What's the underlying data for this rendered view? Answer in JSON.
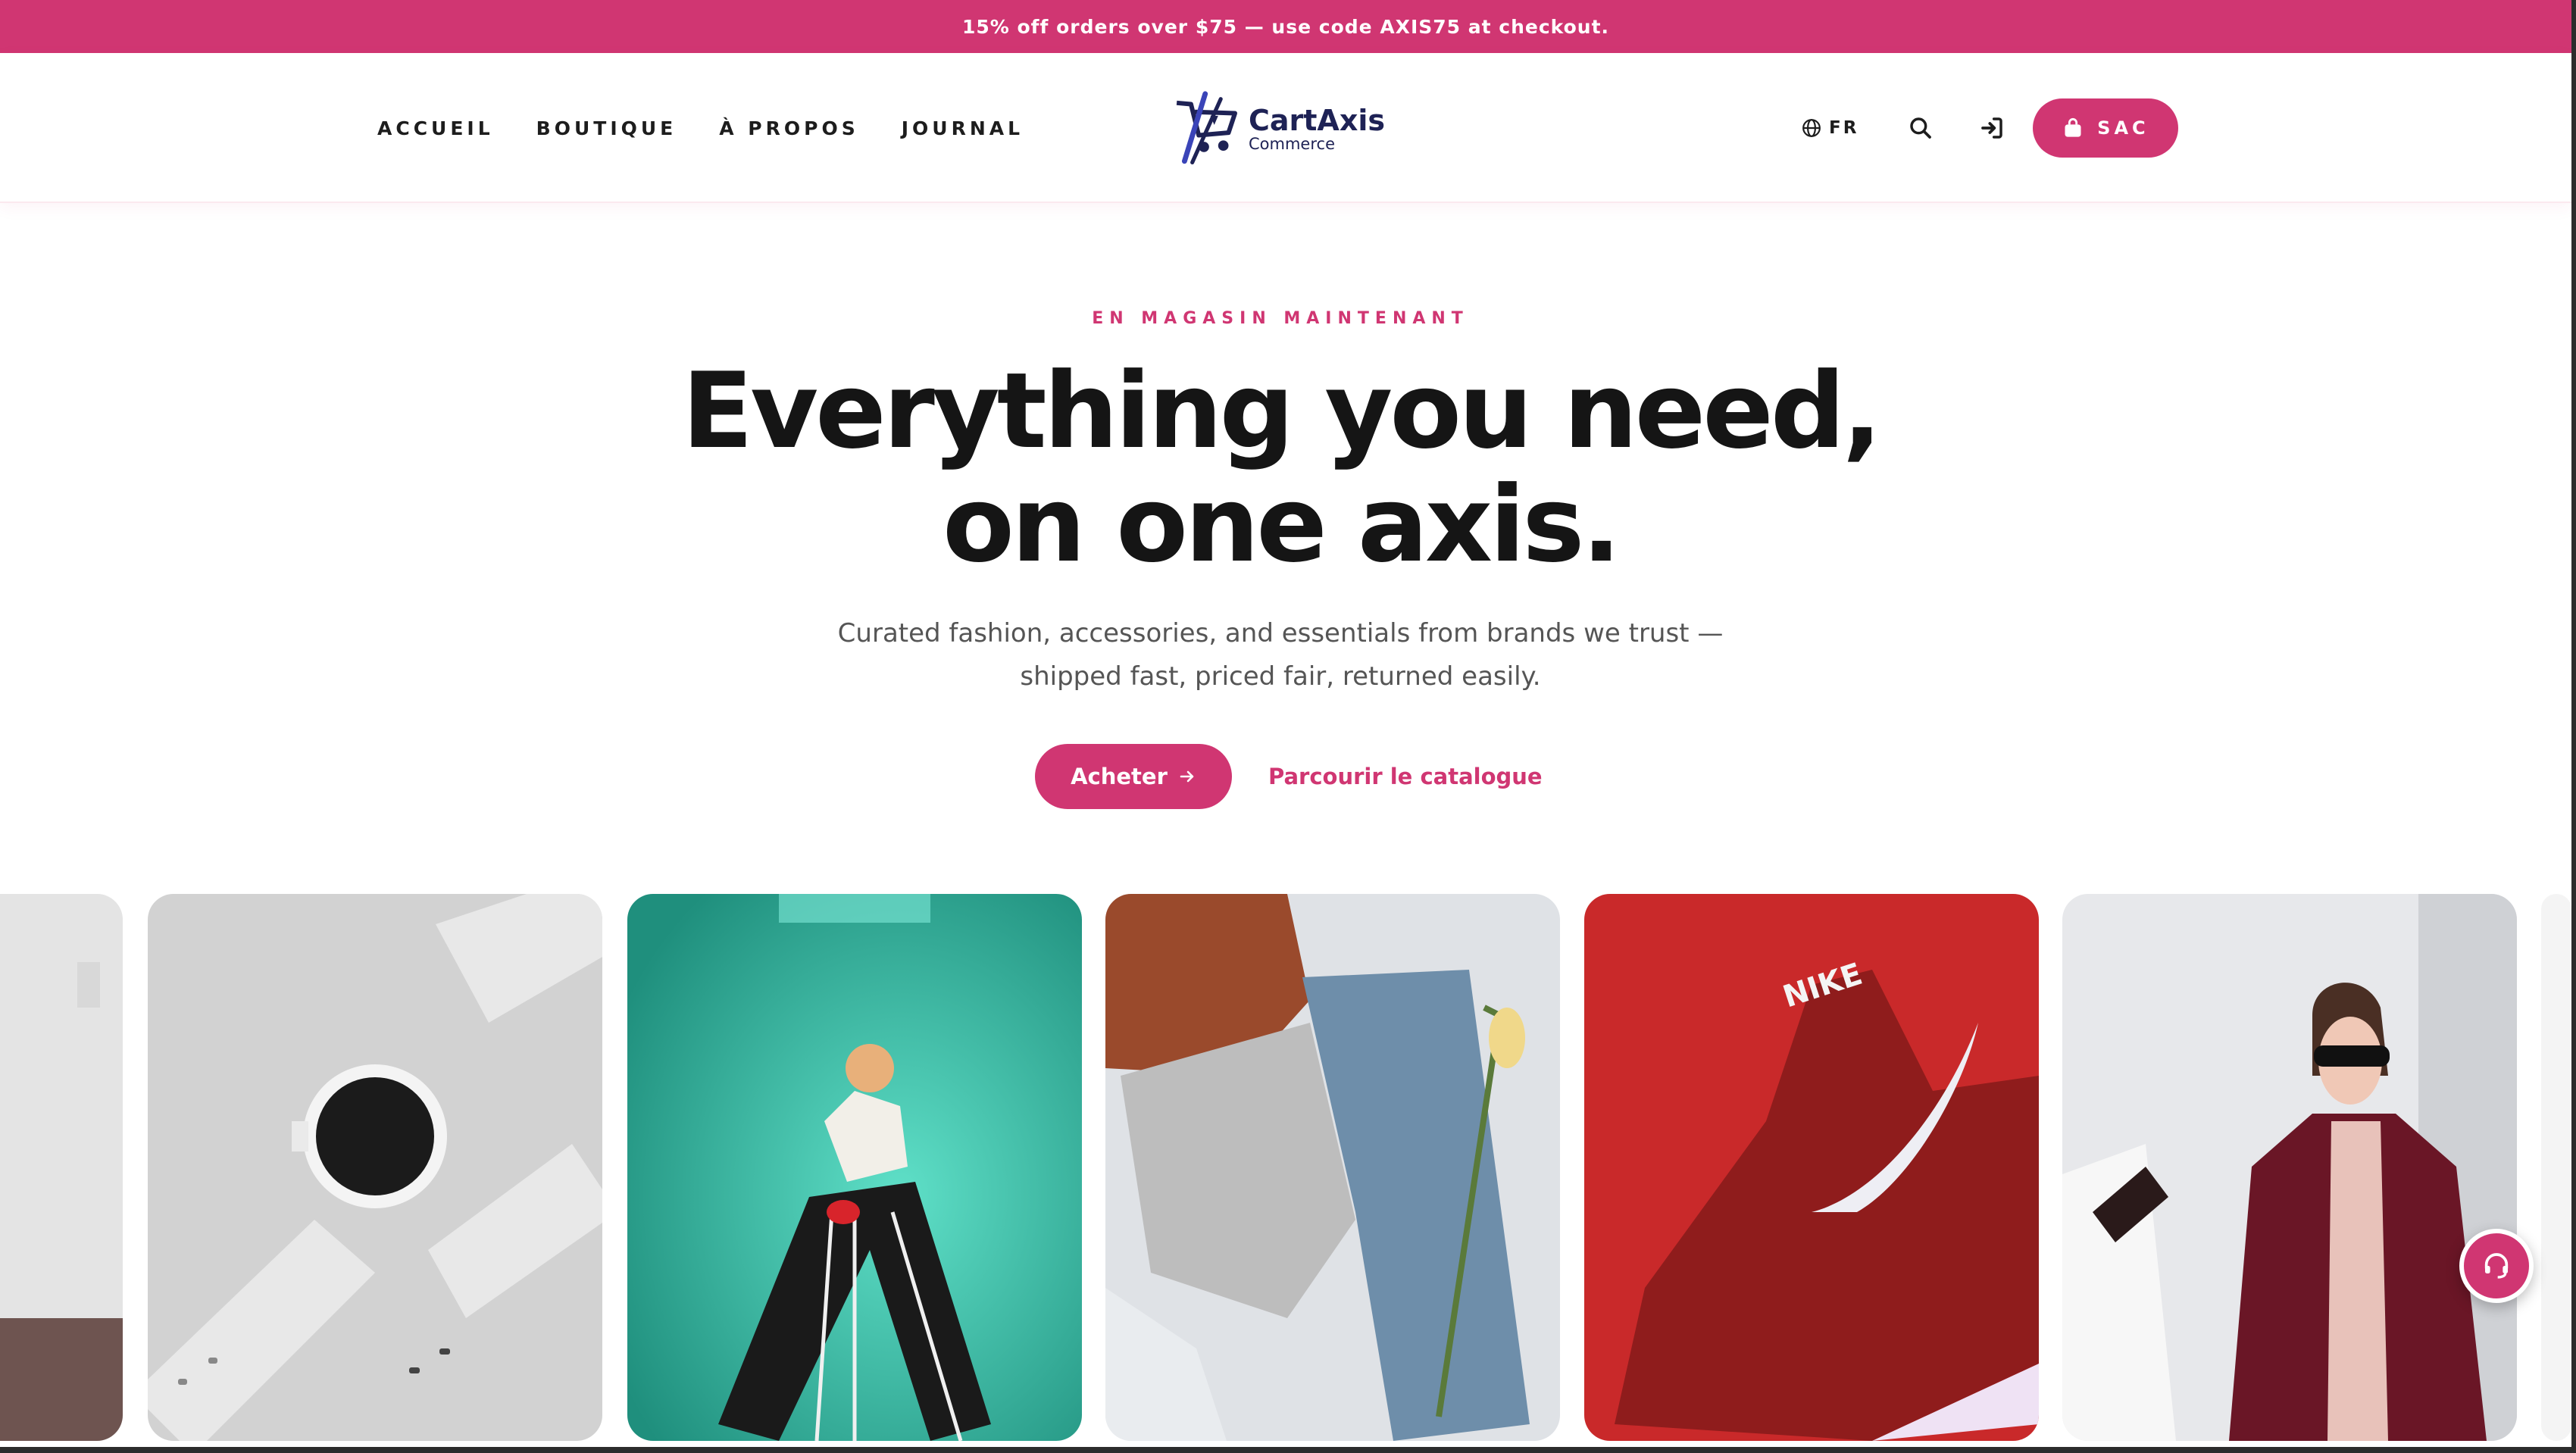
{
  "promo": {
    "text": "15% off orders over $75 — use code AXIS75 at checkout."
  },
  "nav": {
    "items": [
      {
        "label": "ACCUEIL"
      },
      {
        "label": "BOUTIQUE"
      },
      {
        "label": "À PROPOS"
      },
      {
        "label": "JOURNAL"
      }
    ]
  },
  "brand": {
    "name": "CartAxis",
    "tagline": "Commerce"
  },
  "header": {
    "language": "FR",
    "language_icon": "globe-icon",
    "search_icon": "search-icon",
    "login_icon": "sign-in-icon",
    "bag_label": "SAC",
    "bag_icon": "shopping-bag-icon"
  },
  "hero": {
    "eyebrow": "EN MAGASIN MAINTENANT",
    "headline_line1": "Everything you need,",
    "headline_line2": "on one axis.",
    "subtext_line1": "Curated fashion, accessories, and essentials from brands we trust —",
    "subtext_line2": "shipped fast, priced fair, returned easily.",
    "primary_cta": "Acheter",
    "secondary_cta": "Parcourir le catalogue"
  },
  "gallery": {
    "items": [
      {
        "subject": "interior-photo"
      },
      {
        "subject": "white-smartwatch"
      },
      {
        "subject": "woman-teal-wall"
      },
      {
        "subject": "knit-beanie-sweater-jeans-tulips"
      },
      {
        "subject": "red-nike-sneaker"
      },
      {
        "subject": "woman-burgundy-coat-sunglasses"
      }
    ],
    "sneaker_brand_text": "NIKE"
  },
  "support": {
    "icon": "headset-icon"
  },
  "colors": {
    "accent": "#d03672",
    "brand_navy": "#1e2255",
    "text_dark": "#151515"
  }
}
